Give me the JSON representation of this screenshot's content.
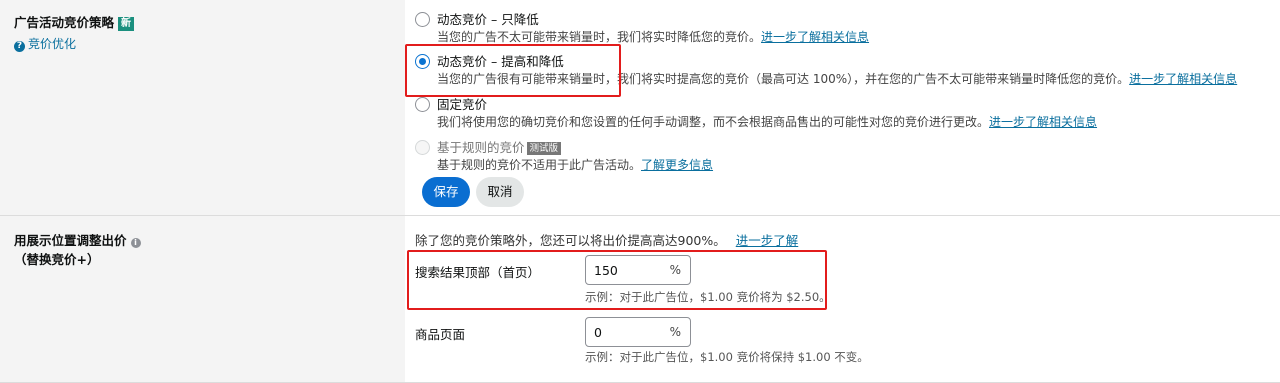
{
  "strategy": {
    "title": "广告活动竞价策略",
    "new_badge": "新",
    "help_link": "竞价优化",
    "options": [
      {
        "label": "动态竞价 – 只降低",
        "desc": "当您的广告不太可能带来销量时，我们将实时降低您的竞价。",
        "link": "进一步了解相关信息",
        "checked": false,
        "disabled": false
      },
      {
        "label": "动态竞价 – 提高和降低",
        "desc": "当您的广告很有可能带来销量时，我们将实时提高您的竞价（最高可达 100%），并在您的广告不太可能带来销量时降低您的竞价。",
        "link": "进一步了解相关信息",
        "checked": true,
        "disabled": false
      },
      {
        "label": "固定竞价",
        "desc": "我们将使用您的确切竞价和您设置的任何手动调整，而不会根据商品售出的可能性对您的竞价进行更改。",
        "link": "进一步了解相关信息",
        "checked": false,
        "disabled": false
      },
      {
        "label": "基于规则的竞价",
        "tag": "测试版",
        "desc": "基于规则的竞价不适用于此广告活动。",
        "link": "了解更多信息",
        "checked": false,
        "disabled": true
      }
    ],
    "save_label": "保存",
    "cancel_label": "取消"
  },
  "placement": {
    "title": "用展示位置调整出价",
    "subtitle": "（替换竞价+）",
    "intro": "除了您的竞价策略外，您还可以将出价提高高达900%。",
    "intro_link": "进一步了解",
    "rows": [
      {
        "label": "搜索结果顶部（首页）",
        "value": "150",
        "unit": "%",
        "example": "示例：对于此广告位，$1.00 竞价将为 $2.50。"
      },
      {
        "label": "商品页面",
        "value": "0",
        "unit": "%",
        "example": "示例：对于此广告位，$1.00 竞价将保持 $1.00 不变。"
      }
    ]
  },
  "colors": {
    "accent": "#0a6ed1",
    "link": "#0a6f9e",
    "highlight": "#e21c1c"
  }
}
